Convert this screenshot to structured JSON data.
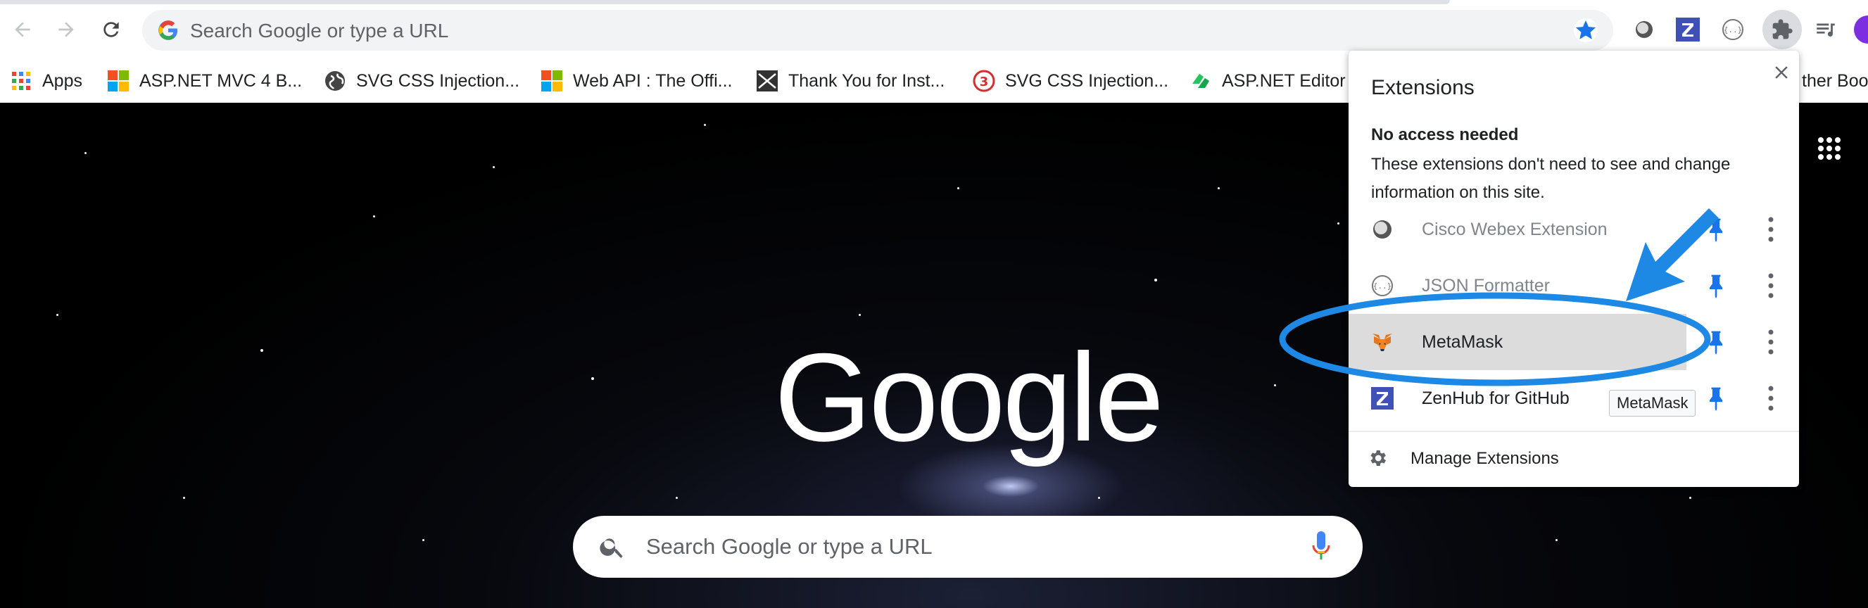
{
  "omnibox": {
    "placeholder": "Search Google or type a URL"
  },
  "bookmarks": [
    {
      "label": "Apps",
      "icon": "apps-grid-icon"
    },
    {
      "label": "ASP.NET MVC 4 B...",
      "icon": "microsoft-logo-icon"
    },
    {
      "label": "SVG CSS Injection...",
      "icon": "globe-icon"
    },
    {
      "label": "Web API : The Offi...",
      "icon": "microsoft-logo-icon"
    },
    {
      "label": "Thank You for Inst...",
      "icon": "envelope-icon"
    },
    {
      "label": "SVG CSS Injection...",
      "icon": "numbered-badge-icon"
    },
    {
      "label": "ASP.NET Editor",
      "icon": "green-logo-icon"
    },
    {
      "label": "ther Boo",
      "icon": ""
    }
  ],
  "ntp": {
    "logo": "Google",
    "search_placeholder": "Search Google or type a URL"
  },
  "extensions_popup": {
    "title": "Extensions",
    "section_heading": "No access needed",
    "section_description": "These extensions don't need to see and change information on this site.",
    "items": [
      {
        "name": "Cisco Webex Extension",
        "icon": "webex-icon",
        "pinned": true,
        "dimmed": true
      },
      {
        "name": "JSON Formatter",
        "icon": "json-formatter-icon",
        "pinned": true,
        "dimmed": true
      },
      {
        "name": "MetaMask",
        "icon": "metamask-fox-icon",
        "pinned": true,
        "highlighted": true
      },
      {
        "name": "ZenHub for GitHub",
        "icon": "zenhub-icon",
        "pinned": true
      }
    ],
    "manage_label": "Manage Extensions",
    "tooltip": "MetaMask"
  },
  "colors": {
    "accent_blue": "#1a73e8",
    "annotation_blue": "#1e88e5",
    "bookmark_star": "#1a73e8"
  }
}
